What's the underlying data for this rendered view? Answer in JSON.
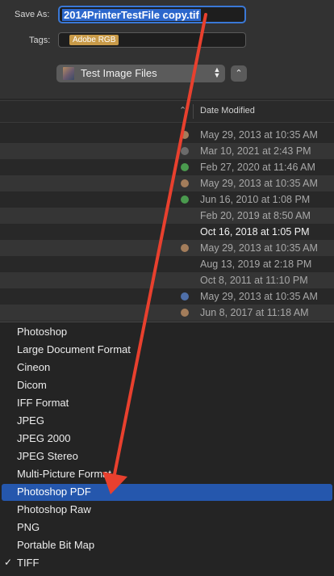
{
  "save_as": {
    "label": "Save As:",
    "value": "2014PrinterTestFile copy.tif"
  },
  "tags": {
    "label": "Tags:",
    "tag": "Adobe RGB",
    "tag_color": "#c89a48"
  },
  "location": {
    "name": "Test Image Files",
    "icon": "folder-image-icon"
  },
  "expand_icon": "chevron-up-icon",
  "list": {
    "column_header": "Date Modified",
    "rows": [
      {
        "date": "May 29, 2013 at 10:35 AM",
        "dot": "#a37d5b"
      },
      {
        "date": "Mar 10, 2021 at 2:43 PM",
        "dot": "#6b6b6b"
      },
      {
        "date": "Feb 27, 2020 at 11:46 AM",
        "dot": "#4a9a4e"
      },
      {
        "date": "May 29, 2013 at 10:35 AM",
        "dot": "#a37d5b"
      },
      {
        "date": "Jun 16, 2010 at 1:08 PM",
        "dot": "#4a9a4e"
      },
      {
        "date": "Feb 20, 2019 at 8:50 AM",
        "dot": ""
      },
      {
        "date": "Oct 16, 2018 at 1:05 PM",
        "dot": "",
        "bright": true
      },
      {
        "date": "May 29, 2013 at 10:35 AM",
        "dot": "#a37d5b"
      },
      {
        "date": "Aug 13, 2019 at 2:18 PM",
        "dot": ""
      },
      {
        "date": "Oct 8, 2011 at 11:10 PM",
        "dot": ""
      },
      {
        "date": "May 29, 2013 at 10:35 AM",
        "dot": "#4f6fa8"
      },
      {
        "date": "Jun 8, 2017 at 11:18 AM",
        "dot": "#a37d5b"
      }
    ]
  },
  "format_menu": {
    "items": [
      {
        "label": "Photoshop"
      },
      {
        "label": "Large Document Format"
      },
      {
        "label": "Cineon"
      },
      {
        "label": "Dicom"
      },
      {
        "label": "IFF Format"
      },
      {
        "label": "JPEG"
      },
      {
        "label": "JPEG 2000"
      },
      {
        "label": "JPEG Stereo"
      },
      {
        "label": "Multi-Picture Format"
      },
      {
        "label": "Photoshop PDF",
        "selected": true
      },
      {
        "label": "Photoshop Raw"
      },
      {
        "label": "PNG"
      },
      {
        "label": "Portable Bit Map"
      },
      {
        "label": "TIFF",
        "checked": true
      }
    ],
    "check_glyph": "✓",
    "selected_color": "#2557ad"
  },
  "annotation": {
    "arrow_color": "#e8402e"
  }
}
